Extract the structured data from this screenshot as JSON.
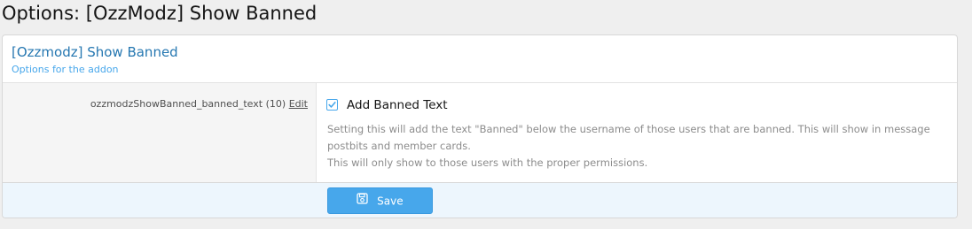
{
  "page": {
    "title": "Options: [OzzModz] Show Banned"
  },
  "block": {
    "title": "[Ozzmodz] Show Banned",
    "description": "Options for the addon"
  },
  "option": {
    "name": "ozzmodzShowBanned_banned_text",
    "order": "(10)",
    "edit_label": "Edit",
    "checkbox_label": "Add Banned Text",
    "checked": true,
    "hint_line1": "Setting this will add the text \"Banned\" below the username of those users that are banned. This will show in message postbits and member cards.",
    "hint_line2": "This will only show to those users with the proper permissions."
  },
  "footer": {
    "save_label": "Save",
    "save_icon": "save-icon"
  },
  "colors": {
    "accent": "#47a7eb",
    "title_link": "#2577b1",
    "footer_bg": "#edf6fd"
  }
}
